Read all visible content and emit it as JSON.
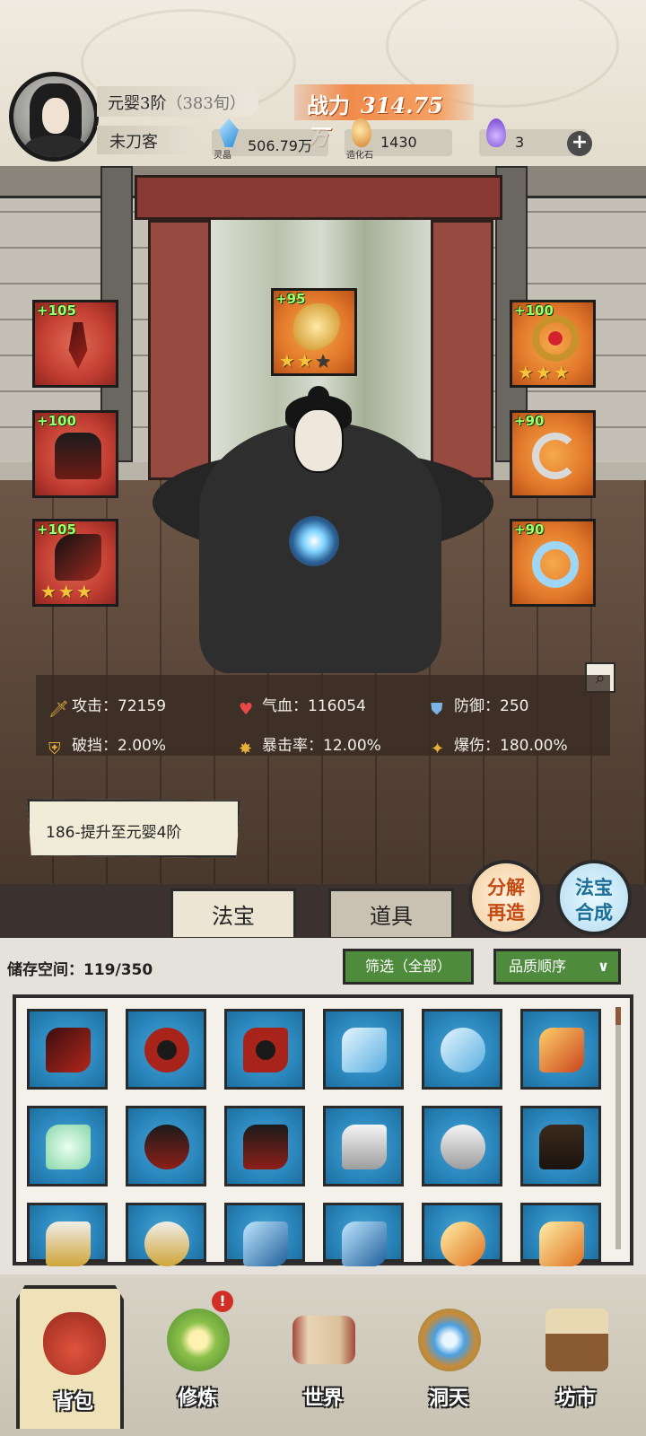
{
  "player": {
    "rank": "元婴3阶",
    "rank_sub": "383旬",
    "name": "未刀客",
    "power_label": "战力",
    "power_value": "314.75万"
  },
  "resources": [
    {
      "name": "灵晶",
      "value": "506.79万",
      "icon": "blue-crystal-icon"
    },
    {
      "name": "造化石",
      "value": "1430",
      "icon": "ore-stone-icon"
    },
    {
      "name": "",
      "value": "3",
      "icon": "purple-flame-icon"
    }
  ],
  "equipment": {
    "left": [
      {
        "level": "+105",
        "icon": "red-sword-hilt-icon",
        "stars": 0
      },
      {
        "level": "+100",
        "icon": "red-armor-icon",
        "stars": 0
      },
      {
        "level": "+105",
        "icon": "red-boots-icon",
        "stars": 3
      }
    ],
    "center": {
      "level": "+95",
      "icon": "golden-dragon-icon",
      "stars": 2,
      "max_stars": 3
    },
    "right": [
      {
        "level": "+100",
        "icon": "golden-ring-icon",
        "stars": 3
      },
      {
        "level": "+90",
        "icon": "silver-pendant-icon",
        "stars": 0
      },
      {
        "level": "+90",
        "icon": "ice-bracelet-icon",
        "stars": 0
      }
    ]
  },
  "stats": {
    "attack": "攻击：72159",
    "hp": "气血：116054",
    "defense": "防御：250",
    "pierce": "破挡：2.00%",
    "crit_rate": "暴击率：12.00%",
    "crit_dmg": "爆伤：180.00%"
  },
  "quest": "186-提升至元婴4阶",
  "tabs": {
    "artifacts": "法宝",
    "items": "道具"
  },
  "actions": {
    "decompose_l1": "分解",
    "decompose_l2": "再造",
    "synth_l1": "法宝",
    "synth_l2": "合成"
  },
  "inventory": {
    "storage_label": "储存空间：",
    "storage_value": "119/350",
    "filter_label": "筛选（全部）",
    "sort_label": "品质顺序",
    "items": [
      "red-sword-hilt-icon",
      "red-spiked-wheel-icon",
      "red-spiked-wheel-icon",
      "blue-bow-icon",
      "blue-bow-icon",
      "flame-axe-icon",
      "jade-fan-icon",
      "red-armor-icon",
      "red-armor-icon",
      "white-robe-icon",
      "white-robe-icon",
      "dark-robe-icon",
      "gold-armor-icon",
      "gold-armor-icon",
      "blue-scale-icon",
      "blue-scale-icon",
      "flame-wing-icon",
      "flame-wing-icon"
    ]
  },
  "nav": [
    {
      "label": "背包",
      "icon": "bag-icon"
    },
    {
      "label": "修炼",
      "icon": "lotus-icon"
    },
    {
      "label": "世界",
      "icon": "scroll-map-icon"
    },
    {
      "label": "洞天",
      "icon": "portal-icon"
    },
    {
      "label": "坊市",
      "icon": "market-icon"
    }
  ],
  "colors": {
    "power": "#f08b4a",
    "level_green": "#9dff6b",
    "star": "#f6c33a",
    "item_bg": "#2a86bc"
  }
}
